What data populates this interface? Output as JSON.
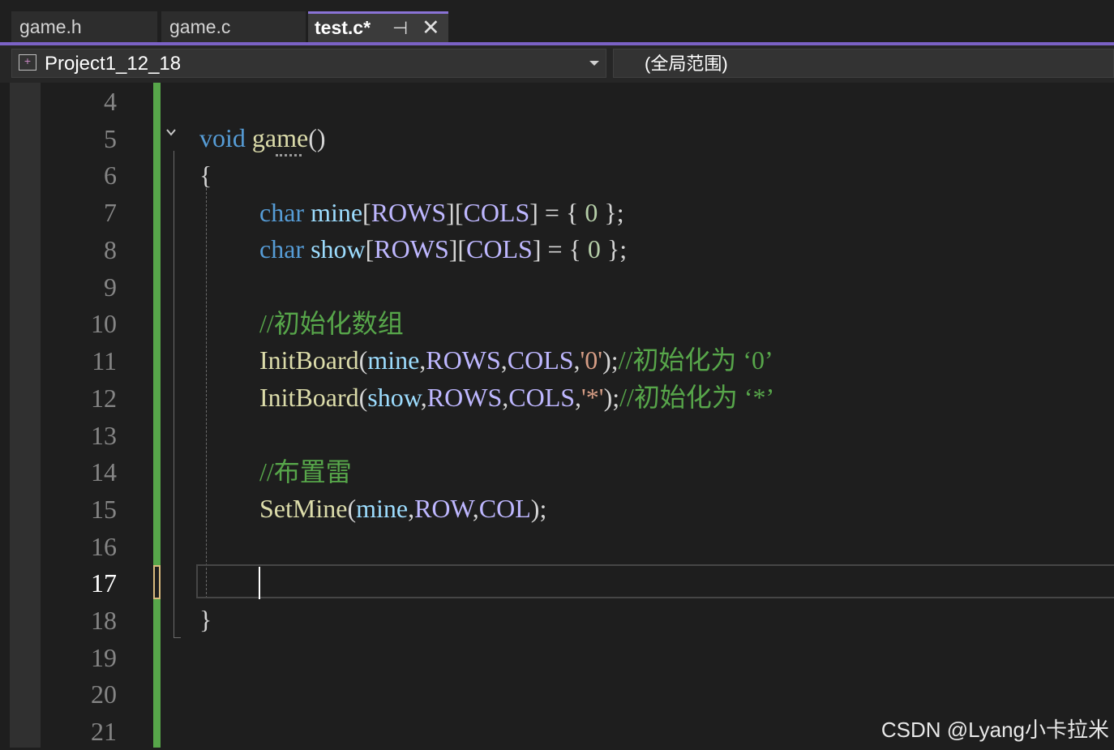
{
  "tabs": [
    {
      "label": "game.h",
      "active": false
    },
    {
      "label": "game.c",
      "active": false
    },
    {
      "label": "test.c*",
      "active": true
    }
  ],
  "tab_icons": {
    "pin": "pin-icon",
    "close": "close-icon"
  },
  "navbar": {
    "project": "Project1_12_18",
    "project_icon": "project-icon",
    "scope": "(全局范围)"
  },
  "editor": {
    "current_line": 17,
    "line_numbers": [
      "4",
      "5",
      "6",
      "7",
      "8",
      "9",
      "10",
      "11",
      "12",
      "13",
      "14",
      "15",
      "16",
      "17",
      "18",
      "19",
      "20",
      "21"
    ],
    "lines": {
      "l5": {
        "kw": "void",
        "fn": "game",
        "paren": "()"
      },
      "l6": {
        "brace": "{"
      },
      "l7": {
        "kw": "char",
        "var": "mine",
        "b1": "[",
        "m1": "ROWS",
        "b2": "][",
        "m2": "COLS",
        "b3": "]",
        "eq": " = { ",
        "num": "0",
        "end": " };"
      },
      "l8": {
        "kw": "char",
        "var": "show",
        "b1": "[",
        "m1": "ROWS",
        "b2": "][",
        "m2": "COLS",
        "b3": "]",
        "eq": " = { ",
        "num": "0",
        "end": " };"
      },
      "l10": {
        "cmt": "//初始化数组"
      },
      "l11": {
        "fn": "InitBoard",
        "p1": "(",
        "var": "mine",
        "c1": ",",
        "m1": "ROWS",
        "c2": ",",
        "m2": "COLS",
        "c3": ",",
        "str": "'0'",
        "end": ");",
        "cmt": "//初始化为 ‘0’"
      },
      "l12": {
        "fn": "InitBoard",
        "p1": "(",
        "var": "show",
        "c1": ",",
        "m1": "ROWS",
        "c2": ",",
        "m2": "COLS",
        "c3": ",",
        "str": "'*'",
        "end": ");",
        "cmt": "//初始化为 ‘*’"
      },
      "l14": {
        "cmt": "//布置雷"
      },
      "l15": {
        "fn": "SetMine",
        "p1": "(",
        "var": "mine",
        "c1": ",",
        "m1": "ROW",
        "c2": ",",
        "m2": "COL",
        "end": ");"
      },
      "l18": {
        "brace": "}"
      }
    }
  },
  "watermark": "CSDN @Lyang小卡拉米",
  "colors": {
    "accent": "#7b62c6",
    "keyword": "#569cd6",
    "function": "#dcdcaa",
    "variable": "#9cdcfe",
    "macro": "#beb7ff",
    "comment": "#57a64a",
    "change_bar": "#57a64a"
  }
}
